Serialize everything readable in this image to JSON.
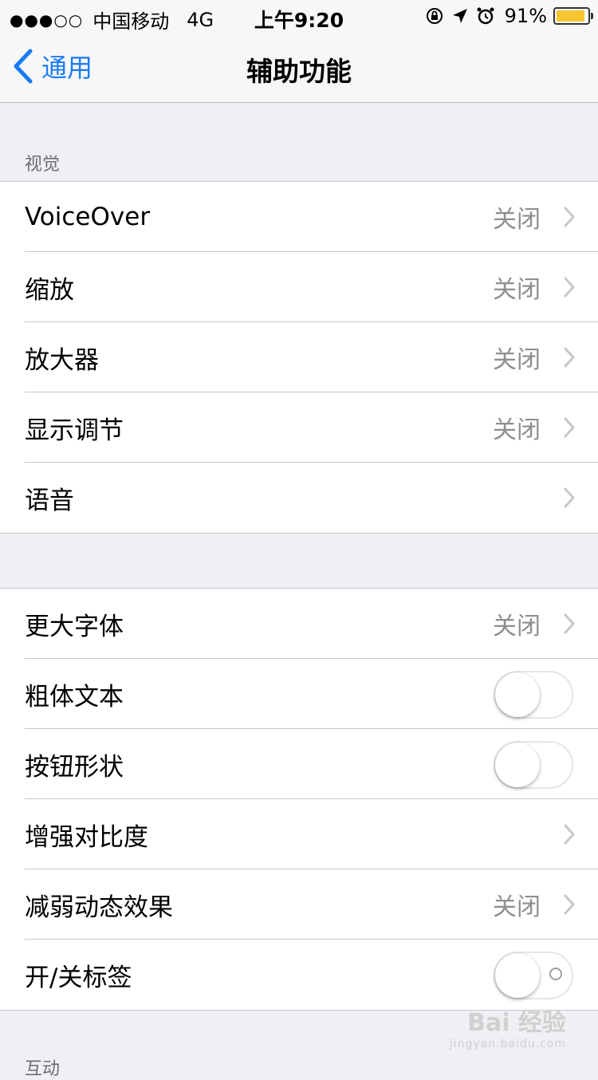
{
  "status_bar": {
    "signal": "●●●○○",
    "carrier": "中国移动",
    "network": "4G",
    "time": "上午9:20",
    "battery_percent": "91%",
    "battery_level": 0.91,
    "icons": [
      "rotation-lock-icon",
      "location-arrow-icon",
      "alarm-icon"
    ],
    "battery_color": "#f6c531"
  },
  "nav": {
    "back_label": "通用",
    "title": "辅助功能",
    "accent_color": "#1a7cf6"
  },
  "sections": [
    {
      "header": "视觉",
      "rows": [
        {
          "label": "VoiceOver",
          "value": "关闭",
          "type": "disclosure"
        },
        {
          "label": "缩放",
          "value": "关闭",
          "type": "disclosure"
        },
        {
          "label": "放大器",
          "value": "关闭",
          "type": "disclosure"
        },
        {
          "label": "显示调节",
          "value": "关闭",
          "type": "disclosure"
        },
        {
          "label": "语音",
          "value": "",
          "type": "disclosure"
        }
      ]
    },
    {
      "header": "",
      "rows": [
        {
          "label": "更大字体",
          "value": "关闭",
          "type": "disclosure"
        },
        {
          "label": "粗体文本",
          "type": "toggle",
          "on": false
        },
        {
          "label": "按钮形状",
          "type": "toggle",
          "on": false
        },
        {
          "label": "增强对比度",
          "value": "",
          "type": "disclosure"
        },
        {
          "label": "减弱动态效果",
          "value": "关闭",
          "type": "disclosure"
        },
        {
          "label": "开/关标签",
          "type": "toggle",
          "on": false
        }
      ]
    },
    {
      "header": "互动"
    }
  ],
  "watermark": {
    "text": "Bai 经验",
    "sub": "jingyan.baidu.com"
  }
}
